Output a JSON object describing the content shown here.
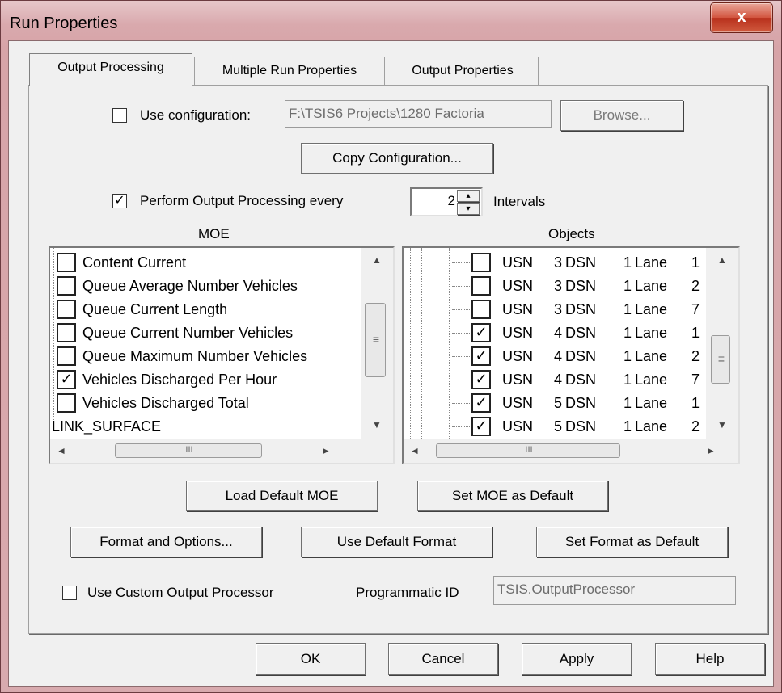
{
  "window": {
    "title": "Run Properties",
    "close_glyph": "x"
  },
  "tabs": [
    {
      "label": "Output Processing",
      "active": true
    },
    {
      "label": "Multiple Run Properties",
      "active": false
    },
    {
      "label": "Output Properties",
      "active": false
    }
  ],
  "configuration": {
    "use_label": "Use configuration:",
    "checked": false,
    "path_value": "F:\\TSIS6 Projects\\1280 Factoria",
    "browse_label": "Browse...",
    "copy_label": "Copy Configuration..."
  },
  "perform": {
    "label": "Perform Output Processing every",
    "checked": true,
    "interval_value": "2",
    "intervals_label": "Intervals"
  },
  "moe": {
    "header": "MOE",
    "items": [
      {
        "label": "Content Current",
        "checked": false
      },
      {
        "label": "Queue Average Number Vehicles",
        "checked": false
      },
      {
        "label": "Queue Current Length",
        "checked": false
      },
      {
        "label": "Queue Current Number Vehicles",
        "checked": false
      },
      {
        "label": "Queue Maximum Number Vehicles",
        "checked": false
      },
      {
        "label": "Vehicles Discharged Per Hour",
        "checked": true
      },
      {
        "label": "Vehicles Discharged Total",
        "checked": false
      }
    ],
    "group_label": "LINK_SURFACE"
  },
  "objects": {
    "header": "Objects",
    "items": [
      {
        "usn": "USN",
        "usn_num": "3",
        "dsn": "DSN",
        "dsn_num": "1",
        "lane": "Lane",
        "lane_num": "1",
        "checked": false
      },
      {
        "usn": "USN",
        "usn_num": "3",
        "dsn": "DSN",
        "dsn_num": "1",
        "lane": "Lane",
        "lane_num": "2",
        "checked": false
      },
      {
        "usn": "USN",
        "usn_num": "3",
        "dsn": "DSN",
        "dsn_num": "1",
        "lane": "Lane",
        "lane_num": "7",
        "checked": false
      },
      {
        "usn": "USN",
        "usn_num": "4",
        "dsn": "DSN",
        "dsn_num": "1",
        "lane": "Lane",
        "lane_num": "1",
        "checked": true
      },
      {
        "usn": "USN",
        "usn_num": "4",
        "dsn": "DSN",
        "dsn_num": "1",
        "lane": "Lane",
        "lane_num": "2",
        "checked": true
      },
      {
        "usn": "USN",
        "usn_num": "4",
        "dsn": "DSN",
        "dsn_num": "1",
        "lane": "Lane",
        "lane_num": "7",
        "checked": true
      },
      {
        "usn": "USN",
        "usn_num": "5",
        "dsn": "DSN",
        "dsn_num": "1",
        "lane": "Lane",
        "lane_num": "1",
        "checked": true
      },
      {
        "usn": "USN",
        "usn_num": "5",
        "dsn": "DSN",
        "dsn_num": "1",
        "lane": "Lane",
        "lane_num": "2",
        "checked": true
      }
    ]
  },
  "buttons": {
    "load_default_moe": "Load Default MOE",
    "set_moe_default": "Set MOE as Default",
    "format_options": "Format and Options...",
    "use_default_format": "Use Default Format",
    "set_format_default": "Set Format as Default"
  },
  "custom_processor": {
    "label": "Use Custom Output Processor",
    "checked": false,
    "prog_id_label": "Programmatic ID",
    "prog_id_value": "TSIS.OutputProcessor"
  },
  "footer": {
    "ok": "OK",
    "cancel": "Cancel",
    "apply": "Apply",
    "help": "Help"
  },
  "icons": {
    "checkmark": "✓",
    "scroll_up": "▲",
    "scroll_down": "▼",
    "scroll_left": "◄",
    "scroll_right": "►",
    "spin_up": "▴",
    "spin_down": "▾",
    "grip_v": "≡",
    "grip_h": "III"
  }
}
